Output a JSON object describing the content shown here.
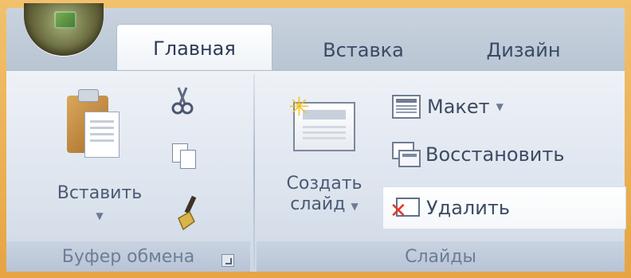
{
  "tabs": [
    {
      "label": "Главная",
      "active": true
    },
    {
      "label": "Вставка",
      "active": false
    },
    {
      "label": "Дизайн",
      "active": false
    }
  ],
  "clipboard_group": {
    "paste_label": "Вставить",
    "group_label": "Буфер обмена",
    "icons": [
      "clipboard-icon",
      "scissors-icon",
      "copy-icon",
      "format-painter-icon"
    ]
  },
  "slides_group": {
    "new_slide_line1": "Создать",
    "new_slide_line2": "слайд",
    "layout_label": "Макет",
    "reset_label": "Восстановить",
    "delete_label": "Удалить",
    "group_label": "Слайды"
  },
  "colors": {
    "frame": "#e8a94a",
    "ribbon": "#dde4ee",
    "tab_text": "#3a4a66",
    "delete_x": "#e03a2a"
  }
}
